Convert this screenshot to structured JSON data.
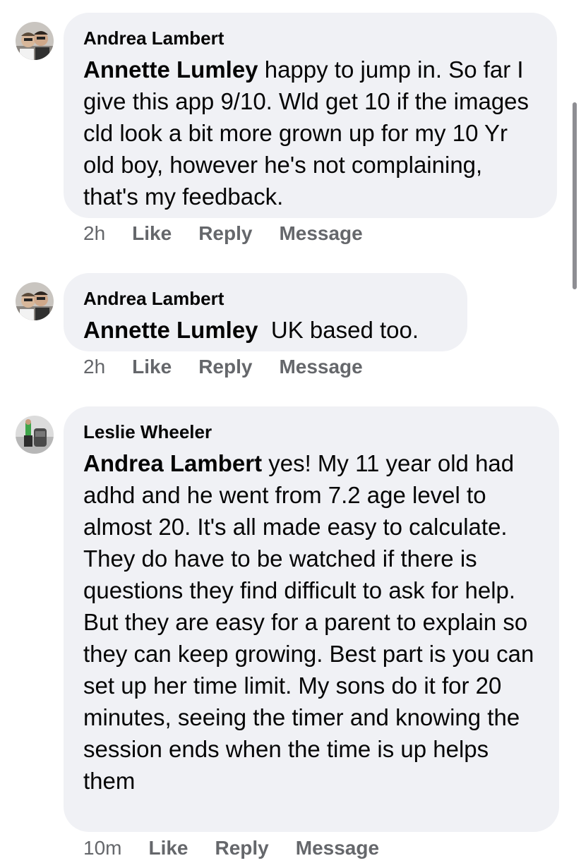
{
  "comments": [
    {
      "author": "Andrea Lambert",
      "mention": "Annette Lumley",
      "body": " happy to jump in. So far I give this app 9/10. Wld get 10 if the images cld look a bit more grown up for my 10 Yr old boy, however he's not complaining, that's my feedback.",
      "time": "2h",
      "like": "Like",
      "reply": "Reply",
      "message": "Message"
    },
    {
      "author": "Andrea Lambert",
      "mention": "Annette Lumley",
      "body": "  UK based too.",
      "time": "2h",
      "like": "Like",
      "reply": "Reply",
      "message": "Message"
    },
    {
      "author": "Leslie Wheeler",
      "mention": "Andrea Lambert",
      "body": " yes! My 11 year old had adhd and he went from 7.2 age level to almost 20. It's all made easy to calculate.  They do have to be watched if there is questions they find difficult to ask for help. But they are easy for a parent to explain so they can keep growing.  Best part is you can set up her time limit.  My sons do it for 20 minutes, seeing the timer and knowing the session ends when the time is up helps them",
      "time": "10m",
      "like": "Like",
      "reply": "Reply",
      "message": "Message"
    }
  ],
  "colors": {
    "bubble": "#f0f1f5",
    "meta_text": "#65676b",
    "body_text": "#050505"
  }
}
